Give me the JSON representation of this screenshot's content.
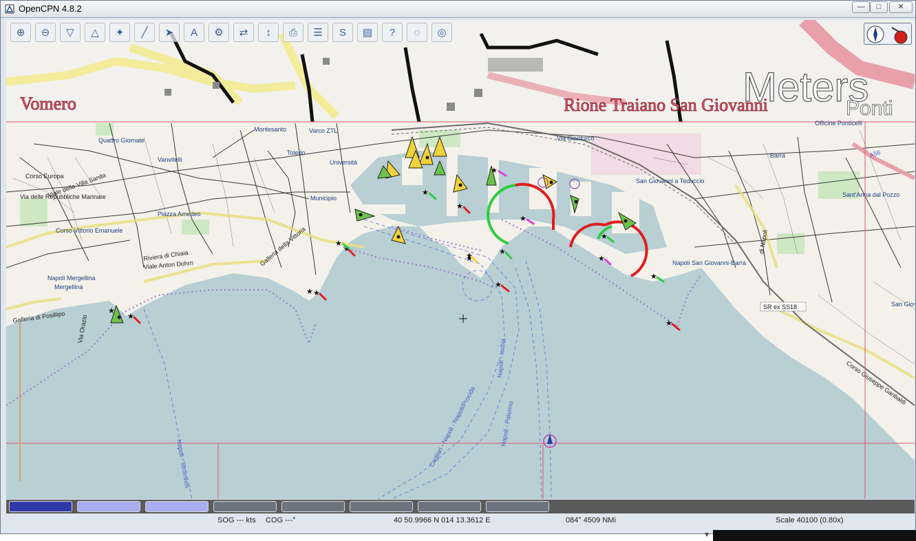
{
  "window": {
    "title": "OpenCPN 4.8.2"
  },
  "window_controls": {
    "min": "—",
    "max": "□",
    "close": "✕"
  },
  "toolbar": [
    {
      "name": "zoom-in-icon",
      "glyph": "⊕"
    },
    {
      "name": "zoom-out-icon",
      "glyph": "⊖"
    },
    {
      "name": "scale-in-icon",
      "glyph": "▽"
    },
    {
      "name": "scale-out-icon",
      "glyph": "△"
    },
    {
      "name": "pan-icon",
      "glyph": "✦"
    },
    {
      "name": "route-icon",
      "glyph": "╱"
    },
    {
      "name": "follow-icon",
      "glyph": "➤"
    },
    {
      "name": "text-icon",
      "glyph": "A"
    },
    {
      "name": "settings-icon",
      "glyph": "⚙"
    },
    {
      "name": "track-icon",
      "glyph": "⇄"
    },
    {
      "name": "move-icon",
      "glyph": "↕"
    },
    {
      "name": "print-icon",
      "glyph": "⎙"
    },
    {
      "name": "route-manager-icon",
      "glyph": "☰"
    },
    {
      "name": "tracking-icon",
      "glyph": "S"
    },
    {
      "name": "color-scheme-icon",
      "glyph": "▤"
    },
    {
      "name": "help-icon",
      "glyph": "?"
    },
    {
      "name": "mob-counter-icon",
      "glyph": "◌"
    },
    {
      "name": "lifebuoy-icon",
      "glyph": "◎"
    }
  ],
  "map_labels": {
    "top_left": "Vomero",
    "top_mid": "Rione Traiano San Giovanni",
    "top_right": "Meters",
    "top_right2": "Ponti",
    "quartieri": [
      "Quattro Giornate",
      "Vanvitelli",
      "Montesanto",
      "Varco ZTL",
      "Università",
      "Via Gianturco",
      "Officine Ponticelli",
      "Barra",
      "Toledo",
      "Municipio",
      "San Giovanni a Teduccio",
      "Sant'Anna dal Pozzo",
      "Piazza Amedeo",
      "Corso Vittorio Emanuele",
      "Riviera di Chiaia",
      "Viale Anton Dohrn",
      "Napoli Mergellina",
      "Mergellina",
      "Galleria della Vittoria",
      "Napoli San Giovanni-Barra",
      "SR ex SS18",
      "San Giov",
      "Via Orazio",
      "Galleria di Posillipo",
      "Corso Giuseppe Garibaldi",
      "Napoli - Ischia",
      "Napoli - Palermo",
      "Napoli - Stromboli",
      "Cagliari - Napoli - Napoli/Procida",
      "A56",
      "Corso Europa",
      "Via delle Repubbliche Marinare",
      "Viale della Villa Sanita",
      "di Napoli"
    ]
  },
  "piano": {
    "keys": [
      "",
      "",
      "",
      "",
      "",
      "",
      "",
      ""
    ],
    "colors": [
      "#2f3aa8",
      "#a9aef0",
      "#a9aef0",
      "#6c7480",
      "#6c7480",
      "#6c7480",
      "#6c7480",
      "#6c7480"
    ]
  },
  "status": {
    "sog": "SOG --- kts",
    "cog": "COG ---°",
    "position": "40 50.9966 N   014 13.3612 E",
    "bearing": "084°  4509 NMi",
    "scale": "Scale 40100 (0.80x)"
  },
  "colors": {
    "water": "#b8cfd4",
    "land": "#f2efe8",
    "road_yellow": "#f5f0a8",
    "road_pink": "#e9a0a8",
    "grid": "#e0566a",
    "anchorage": "#9a7bc8"
  }
}
